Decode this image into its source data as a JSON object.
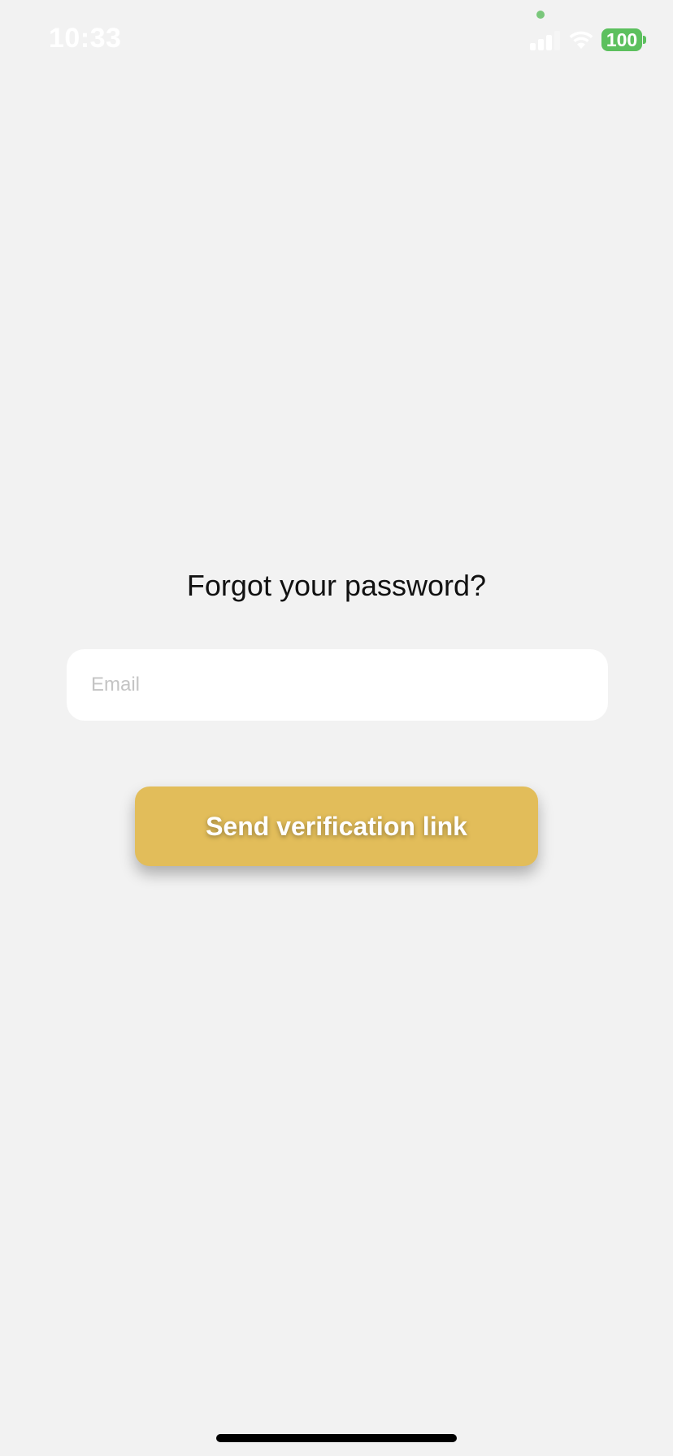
{
  "status_bar": {
    "time": "10:33",
    "battery_level": "100",
    "signal_icon": "cellular-signal-icon",
    "wifi_icon": "wifi-icon",
    "battery_color": "#5cc05e",
    "privacy_dot_color": "#7ac77b"
  },
  "screen": {
    "title": "Forgot your password?",
    "email": {
      "value": "",
      "placeholder": "Email"
    },
    "send_button_label": "Send verification link"
  },
  "colors": {
    "background": "#f2f2f2",
    "button": "#e2bd5a",
    "input_background": "#ffffff"
  }
}
